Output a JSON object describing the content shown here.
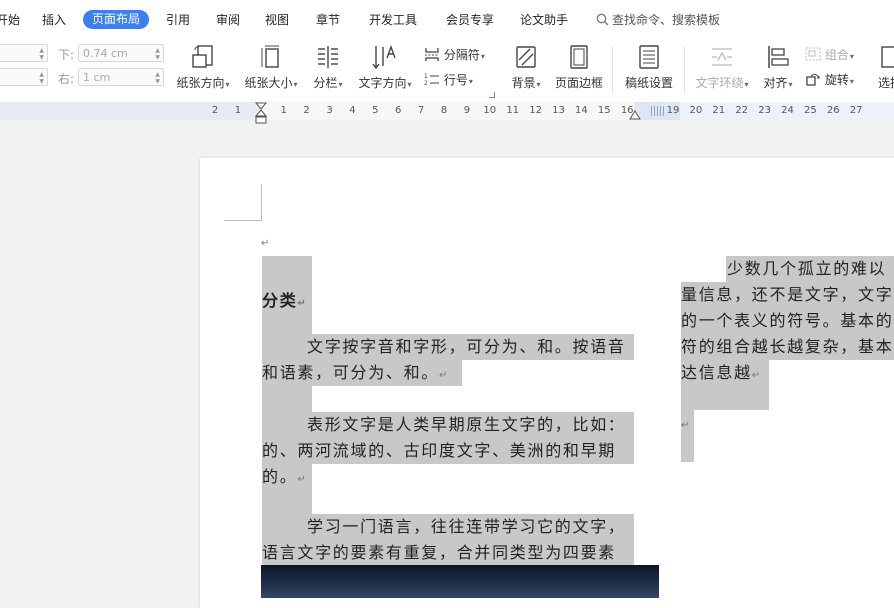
{
  "menu": {
    "items": [
      "开始",
      "插入",
      "页面布局",
      "引用",
      "审阅",
      "视图",
      "章节",
      "开发工具",
      "会员专享",
      "论文助手"
    ],
    "active_index": 2,
    "search_placeholder": "查找命令、搜索模板"
  },
  "toolbar": {
    "margin_bottom_label": "下:",
    "margin_bottom_value": "0.74 cm",
    "margin_right_label": "右:",
    "margin_right_value": "1 cm",
    "orientation": "纸张方向",
    "size": "纸张大小",
    "columns": "分栏",
    "text_direction": "文字方向",
    "breaks": "分隔符",
    "line_numbers": "行号",
    "background": "背景",
    "page_border": "页面边框",
    "manuscript": "稿纸设置",
    "text_wrap": "文字环绕",
    "align": "对齐",
    "group": "组合",
    "rotate": "旋转",
    "select": "选择",
    "accent_color": "#3b7ff1"
  },
  "ruler": {
    "ticks": [
      "2",
      "1",
      "",
      "1",
      "2",
      "3",
      "4",
      "5",
      "6",
      "7",
      "8",
      "9",
      "10",
      "11",
      "12",
      "13",
      "14",
      "15",
      "16",
      "",
      "19",
      "20",
      "21",
      "22",
      "23",
      "24",
      "25",
      "26",
      "27"
    ]
  },
  "document": {
    "para_mark": "↵",
    "heading_tail": "分类",
    "p1_l1": "文字按字音和字形，可分为、和。按语音",
    "p1_l2": "和语素，可分为、和。",
    "p2_l1": "表形文字是人类早期原生文字的，比如：",
    "p2_l2": "的、两河流域的、古印度文字、美洲的和早期",
    "p2_l3": "的。",
    "p3_l1": "学习一门语言，往往连带学习它的文字，",
    "p3_l2": "语言文字的要素有重复，合并同类型为四要素",
    "c2_l1": "少数几个孤立的难以",
    "c2_l2": "量信息，还不是文字，文字",
    "c2_l3": "的一个表义的符号。基本的",
    "c2_l4": "符的组合越长越复杂，基本",
    "c2_l5": "达信息越"
  }
}
